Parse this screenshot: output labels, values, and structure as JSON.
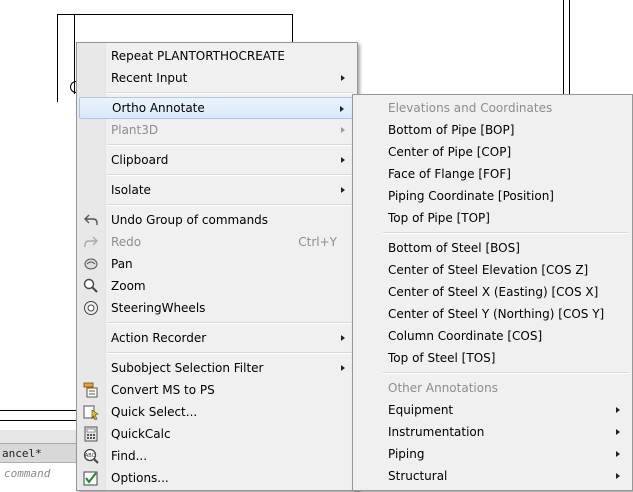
{
  "command_line": {
    "history_text": "ancel*",
    "input_placeholder": "command"
  },
  "context_menu": {
    "items": [
      {
        "label": "Repeat PLANTORTHOCREATE"
      },
      {
        "label": "Recent Input"
      },
      {
        "label": "Ortho Annotate"
      },
      {
        "label": "Plant3D"
      },
      {
        "label": "Clipboard"
      },
      {
        "label": "Isolate"
      },
      {
        "label": "Undo Group of commands",
        "icon": "undo-icon"
      },
      {
        "label": "Redo",
        "icon": "redo-icon",
        "shortcut": "Ctrl+Y"
      },
      {
        "label": "Pan",
        "icon": "pan-icon"
      },
      {
        "label": "Zoom",
        "icon": "zoom-icon"
      },
      {
        "label": "SteeringWheels",
        "icon": "steeringwheels-icon"
      },
      {
        "label": "Action Recorder"
      },
      {
        "label": "Subobject Selection Filter"
      },
      {
        "label": "Convert MS to PS",
        "icon": "convert-ms-ps-icon"
      },
      {
        "label": "Quick Select...",
        "icon": "quick-select-icon"
      },
      {
        "label": "QuickCalc",
        "icon": "calculator-icon"
      },
      {
        "label": "Find...",
        "icon": "find-icon"
      },
      {
        "label": "Options...",
        "icon": "options-check-icon"
      }
    ]
  },
  "submenu": {
    "header_elevations": "Elevations and Coordinates",
    "items": [
      {
        "label": "Bottom of Pipe [BOP]"
      },
      {
        "label": "Center of Pipe [COP]"
      },
      {
        "label": "Face of Flange [FOF]"
      },
      {
        "label": "Piping Coordinate [Position]"
      },
      {
        "label": "Top of Pipe [TOP]"
      },
      {
        "label": "Bottom of Steel [BOS]"
      },
      {
        "label": "Center of Steel Elevation [COS Z]"
      },
      {
        "label": "Center of Steel X (Easting) [COS X]"
      },
      {
        "label": "Center of Steel Y (Northing) [COS Y]"
      },
      {
        "label": "Column Coordinate [COS]"
      },
      {
        "label": "Top of Steel [TOS]"
      }
    ],
    "header_other": "Other Annotations",
    "other_items": [
      {
        "label": "Equipment"
      },
      {
        "label": "Instrumentation"
      },
      {
        "label": "Piping"
      },
      {
        "label": "Structural"
      }
    ]
  }
}
